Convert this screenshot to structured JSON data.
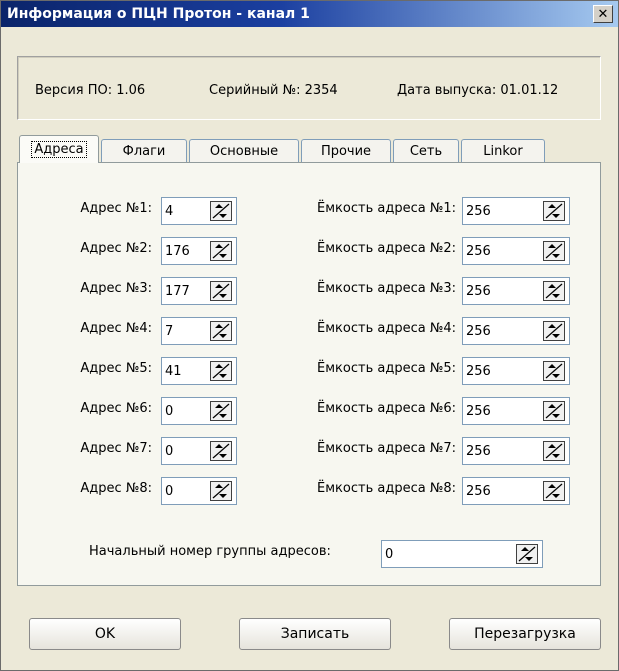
{
  "window": {
    "title": "Информация о ПЦН Протон - канал 1",
    "close_symbol": "✕"
  },
  "info": {
    "version": "Версия ПО: 1.06",
    "serial": "Серийный №: 2354",
    "release_date": "Дата выпуска: 01.01.12"
  },
  "tabs": [
    {
      "label": "Адреса",
      "active": true
    },
    {
      "label": "Флаги",
      "active": false
    },
    {
      "label": "Основные",
      "active": false
    },
    {
      "label": "Прочие",
      "active": false
    },
    {
      "label": "Сеть",
      "active": false
    },
    {
      "label": "Linkor",
      "active": false
    }
  ],
  "addresses": [
    {
      "label": "Адрес №1:",
      "value": "4",
      "capacity_label": "Ёмкость адреса №1:",
      "capacity": "256"
    },
    {
      "label": "Адрес №2:",
      "value": "176",
      "capacity_label": "Ёмкость адреса №2:",
      "capacity": "256"
    },
    {
      "label": "Адрес №3:",
      "value": "177",
      "capacity_label": "Ёмкость адреса №3:",
      "capacity": "256"
    },
    {
      "label": "Адрес №4:",
      "value": "7",
      "capacity_label": "Ёмкость адреса №4:",
      "capacity": "256"
    },
    {
      "label": "Адрес №5:",
      "value": "41",
      "capacity_label": "Ёмкость адреса №5:",
      "capacity": "256"
    },
    {
      "label": "Адрес №6:",
      "value": "0",
      "capacity_label": "Ёмкость адреса №6:",
      "capacity": "256"
    },
    {
      "label": "Адрес №7:",
      "value": "0",
      "capacity_label": "Ёмкость адреса №7:",
      "capacity": "256"
    },
    {
      "label": "Адрес №8:",
      "value": "0",
      "capacity_label": "Ёмкость адреса №8:",
      "capacity": "256"
    }
  ],
  "group_start": {
    "label": "Начальный номер группы адресов:",
    "value": "0"
  },
  "buttons": {
    "ok": "OK",
    "write": "Записать",
    "reboot": "Перезагрузка"
  }
}
